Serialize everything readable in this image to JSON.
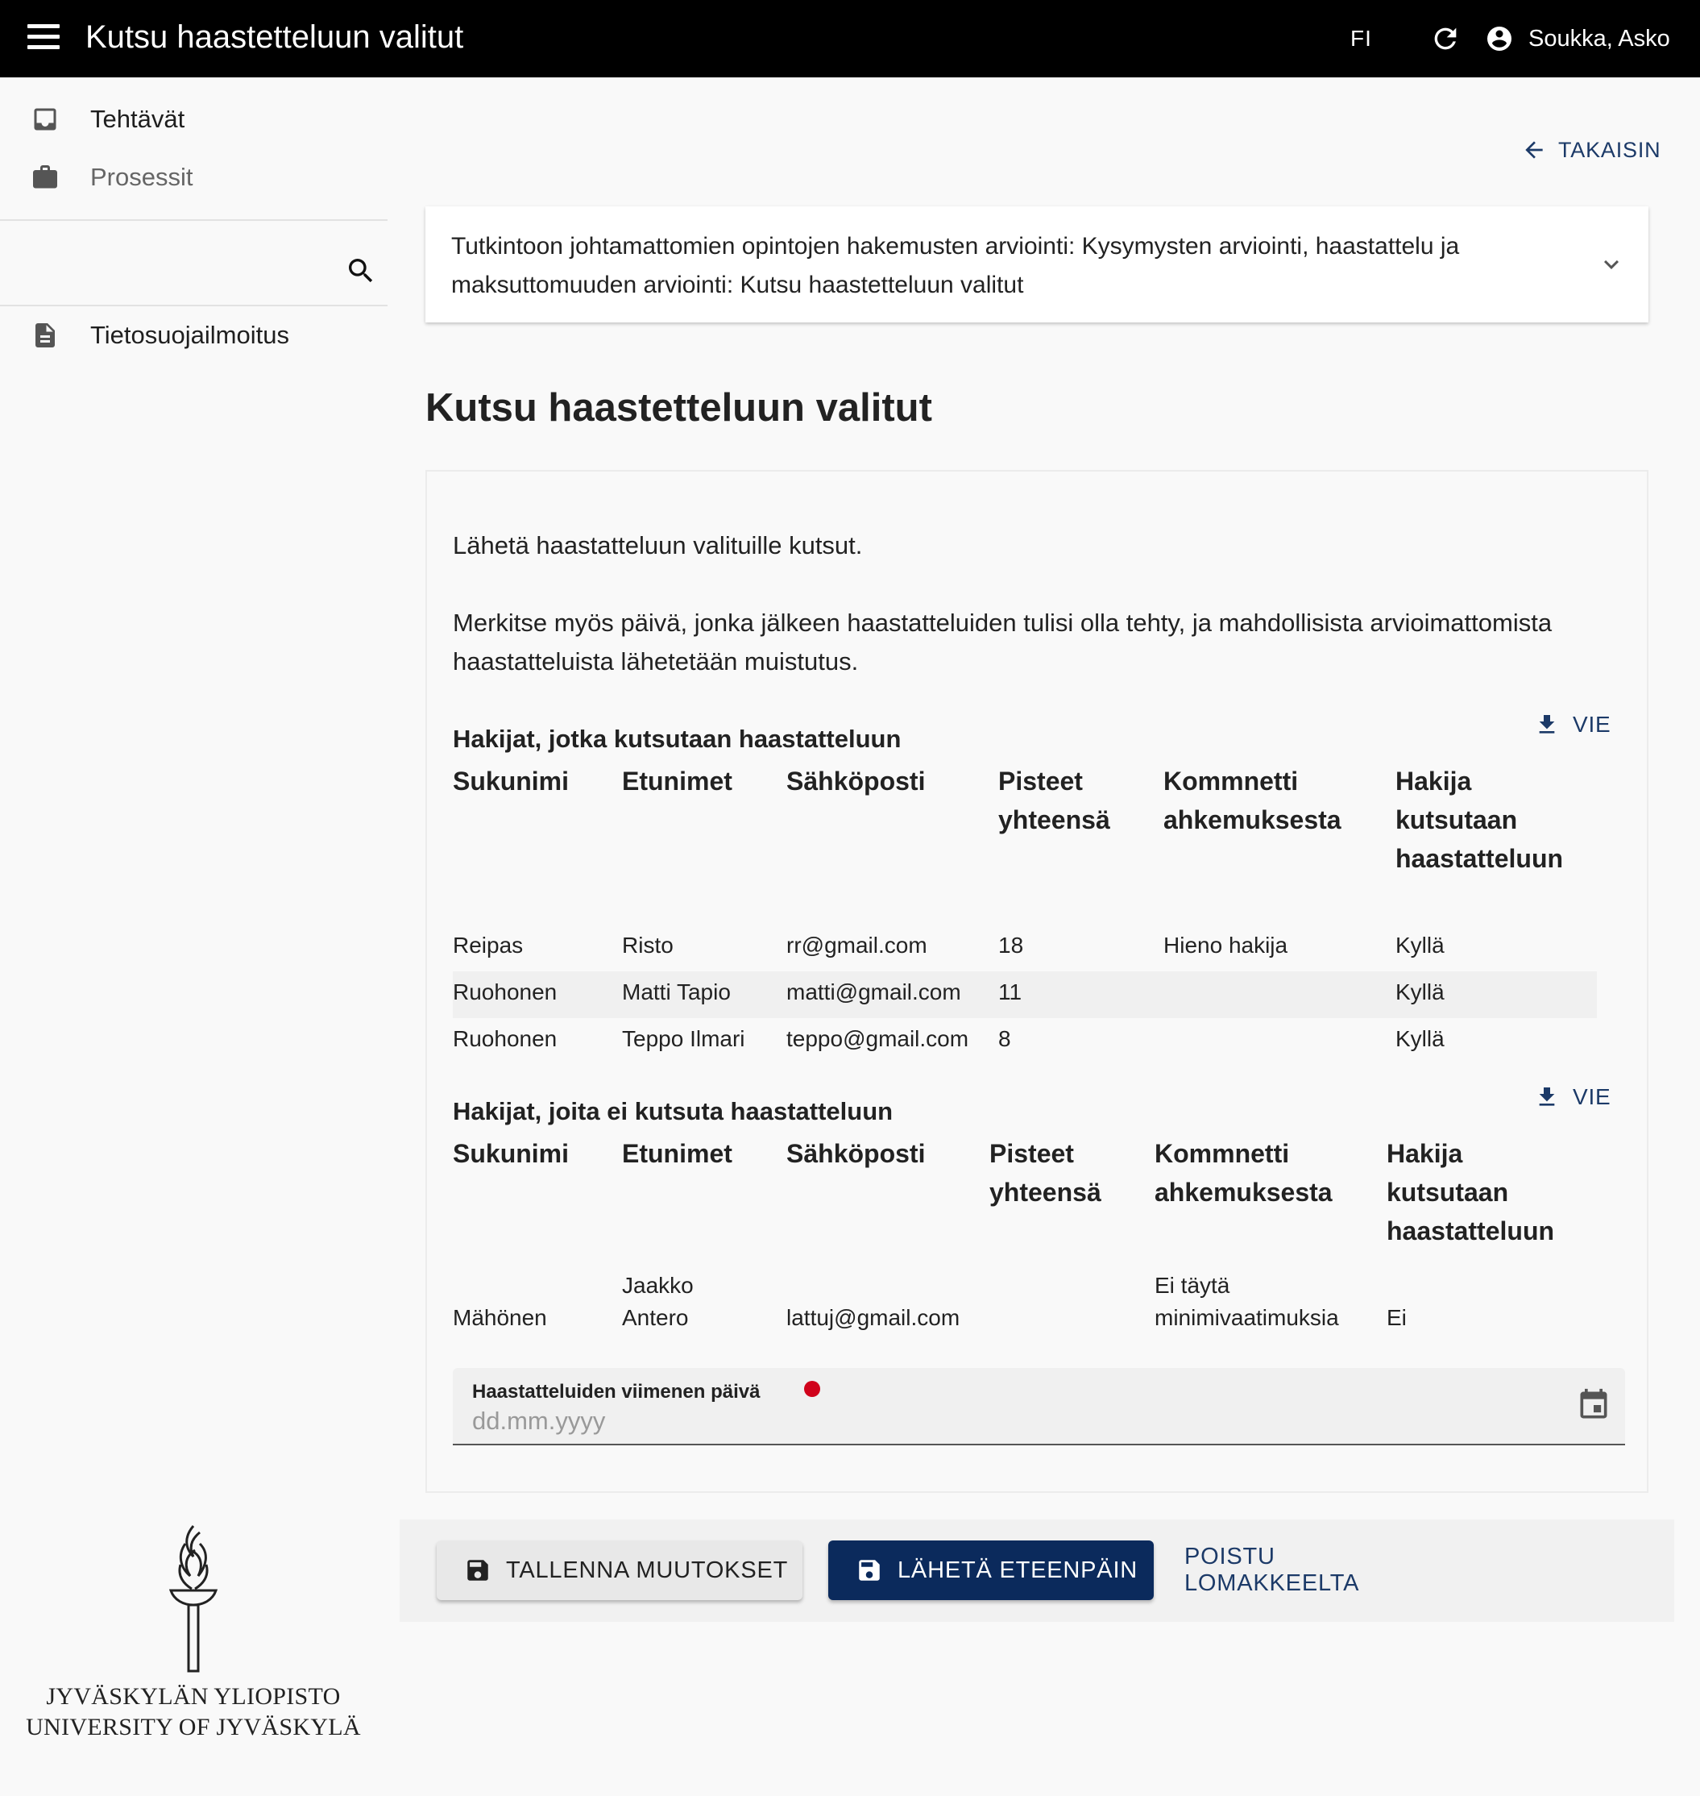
{
  "header": {
    "title": "Kutsu haastetteluun valitut",
    "language": "FI",
    "user_name": "Soukka, Asko"
  },
  "sidebar": {
    "items": [
      {
        "label": "Tehtävät",
        "icon": "inbox-icon"
      },
      {
        "label": "Prosessit",
        "icon": "briefcase-icon"
      }
    ],
    "search_placeholder": "",
    "privacy_label": "Tietosuojailmoitus",
    "logo_line1": "JYVÄSKYLÄN YLIOPISTO",
    "logo_line2": "UNIVERSITY OF JYVÄSKYLÄ"
  },
  "main": {
    "back_label": "TAKAISIN",
    "process_title": "Tutkintoon johtamattomien opintojen hakemusten arviointi: Kysymysten arviointi, haastattelu ja maksuttomuuden arviointi: Kutsu haastetteluun valitut",
    "page_title": "Kutsu haastetteluun valitut",
    "intro1": "Lähetä haastatteluun valituille kutsut.",
    "intro2": "Merkitse myös päivä, jonka jälkeen haastatteluiden tulisi olla tehty, ja mahdollisista arvioimattomista haastatteluista lähetetään muistutus."
  },
  "invited": {
    "title": "Hakijat, jotka kutsutaan haastatteluun",
    "export_label": "VIE",
    "headers": [
      "Sukunimi",
      "Etunimet",
      "Sähköposti",
      "Pisteet yhteensä",
      "Kommnetti ahkemuksesta",
      "Hakija kutsutaan haastatteluun"
    ],
    "rows": [
      [
        "Reipas",
        "Risto",
        "rr@gmail.com",
        "18",
        "Hieno hakija",
        "Kyllä"
      ],
      [
        "Ruohonen",
        "Matti Tapio",
        "matti@gmail.com",
        "11",
        "",
        "Kyllä"
      ],
      [
        "Ruohonen",
        "Teppo Ilmari",
        "teppo@gmail.com",
        "8",
        "",
        "Kyllä"
      ]
    ]
  },
  "not_invited": {
    "title": "Hakijat, joita ei kutsuta haastatteluun",
    "export_label": "VIE",
    "headers": [
      "Sukunimi",
      "Etunimet",
      "Sähköposti",
      "Pisteet yhteensä",
      "Kommnetti ahkemuksesta",
      "Hakija kutsutaan haastatteluun"
    ],
    "rows": [
      [
        "Mähönen",
        "Jaakko Antero",
        "lattuj@gmail.com",
        "",
        "Ei täytä minimivaatimuksia",
        "Ei"
      ]
    ]
  },
  "date_field": {
    "label": "Haastatteluiden viimenen päivä",
    "placeholder": "dd.mm.yyyy",
    "value": ""
  },
  "actions": {
    "save_label": "TALLENNA MUUTOKSET",
    "send_label": "LÄHETÄ ETEENPÄIN",
    "leave_label": "POISTU LOMAKKEELTA"
  },
  "colors": {
    "topbar": "#000000",
    "accent": "#0b2a5c",
    "link": "#1c3a68",
    "required": "#d0021b"
  }
}
